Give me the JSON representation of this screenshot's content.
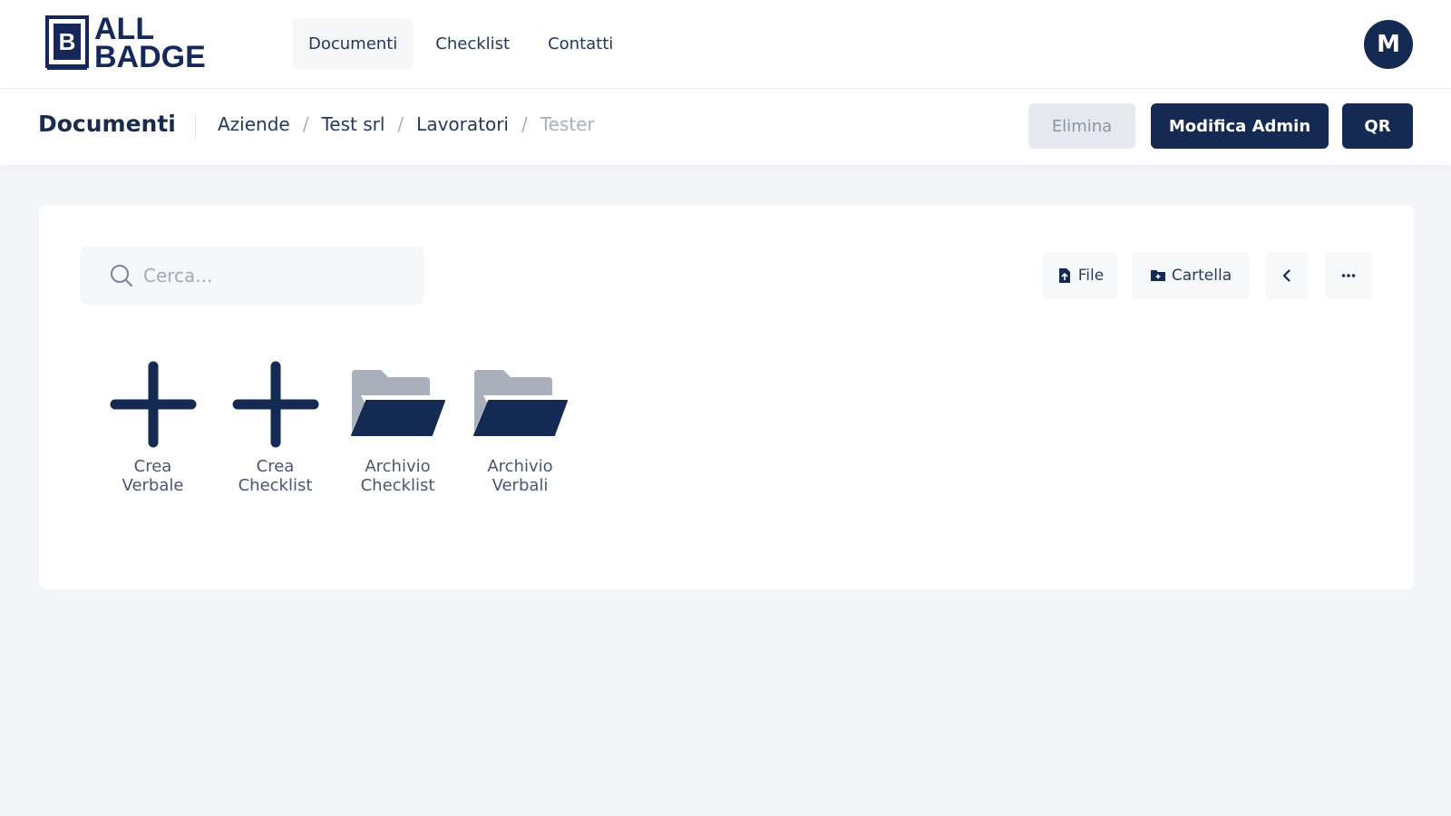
{
  "brand": {
    "line1": "ALL",
    "line2": "BADGE",
    "color": "#16285a"
  },
  "nav": {
    "items": [
      {
        "label": "Documenti",
        "active": true
      },
      {
        "label": "Checklist",
        "active": false
      },
      {
        "label": "Contatti",
        "active": false
      }
    ]
  },
  "user": {
    "initial": "M"
  },
  "header": {
    "title": "Documenti",
    "breadcrumb": [
      "Aziende",
      "Test srl",
      "Lavoratori",
      "Tester"
    ],
    "separator": "/",
    "buttons": {
      "delete_label": "Elimina",
      "edit_admin_label": "Modifica Admin",
      "qr_label": "QR"
    }
  },
  "toolbar": {
    "search_placeholder": "Cerca...",
    "file_label": "File",
    "folder_label": "Cartella",
    "back_icon": "chevron-left-icon",
    "more_icon": "more-horizontal-icon"
  },
  "tiles": [
    {
      "line1": "Crea",
      "line2": "Verbale",
      "icon": "plus-icon"
    },
    {
      "line1": "Crea",
      "line2": "Checklist",
      "icon": "plus-icon"
    },
    {
      "line1": "Archivio",
      "line2": "Checklist",
      "icon": "folder-open-icon"
    },
    {
      "line1": "Archivio",
      "line2": "Verbali",
      "icon": "folder-open-icon"
    }
  ],
  "colors": {
    "primary": "#152a52",
    "background": "#f3f5f8",
    "folder_back": "#a9b0bc"
  }
}
